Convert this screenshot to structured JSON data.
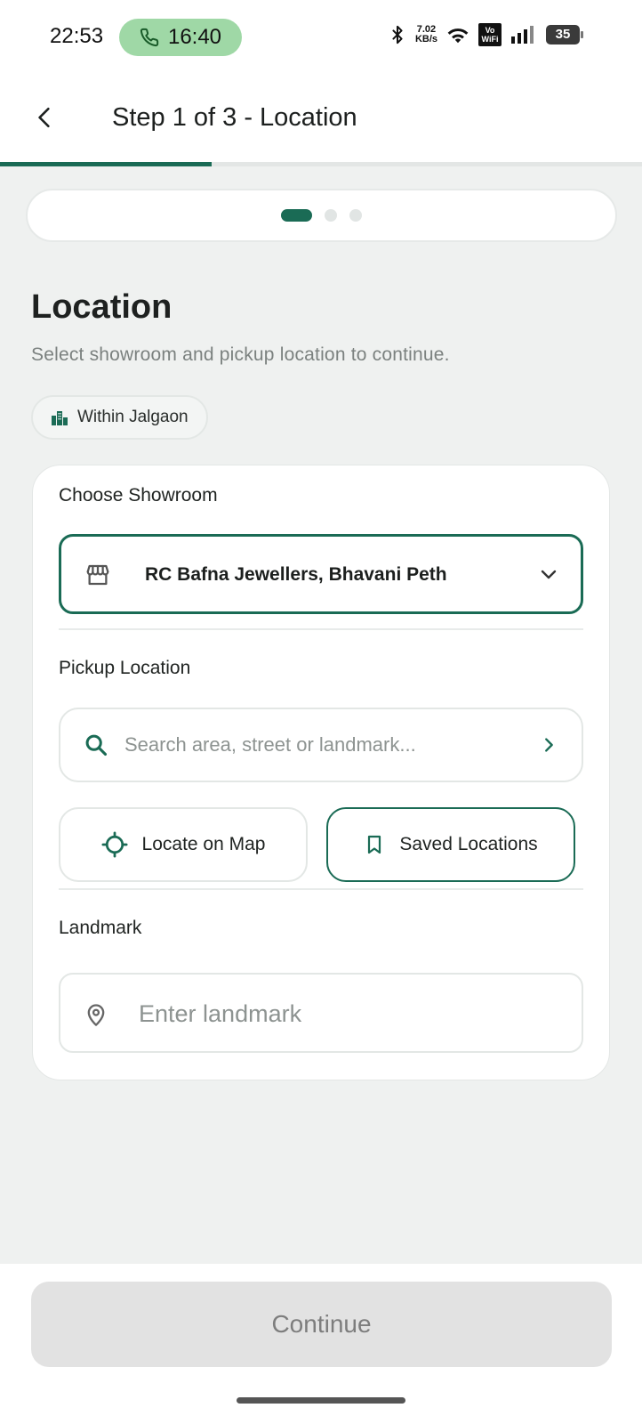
{
  "status_bar": {
    "time": "22:53",
    "call_timer": "16:40",
    "net_speed_value": "7.02",
    "net_speed_unit": "KB/s",
    "vowifi_label_1": "Vo",
    "vowifi_label_2": "WiFi",
    "battery": "35"
  },
  "app_bar": {
    "title": "Step 1 of 3 - Location",
    "progress_percent": 33
  },
  "steps": {
    "total": 3,
    "current": 1
  },
  "section": {
    "title": "Location",
    "subtitle": "Select showroom and pickup location to continue.",
    "chip_label": "Within Jalgaon"
  },
  "form": {
    "showroom_label": "Choose Showroom",
    "showroom_value": "RC Bafna Jewellers, Bhavani Peth",
    "pickup_label": "Pickup Location",
    "pickup_placeholder": "Search area, street or landmark...",
    "locate_label": "Locate on Map",
    "saved_label": "Saved Locations",
    "landmark_label": "Landmark",
    "landmark_placeholder": "Enter landmark"
  },
  "footer": {
    "continue_label": "Continue"
  },
  "colors": {
    "accent": "#1a6b55",
    "call_pill": "#9fd8a6",
    "disabled_btn": "#e2e2e2"
  }
}
